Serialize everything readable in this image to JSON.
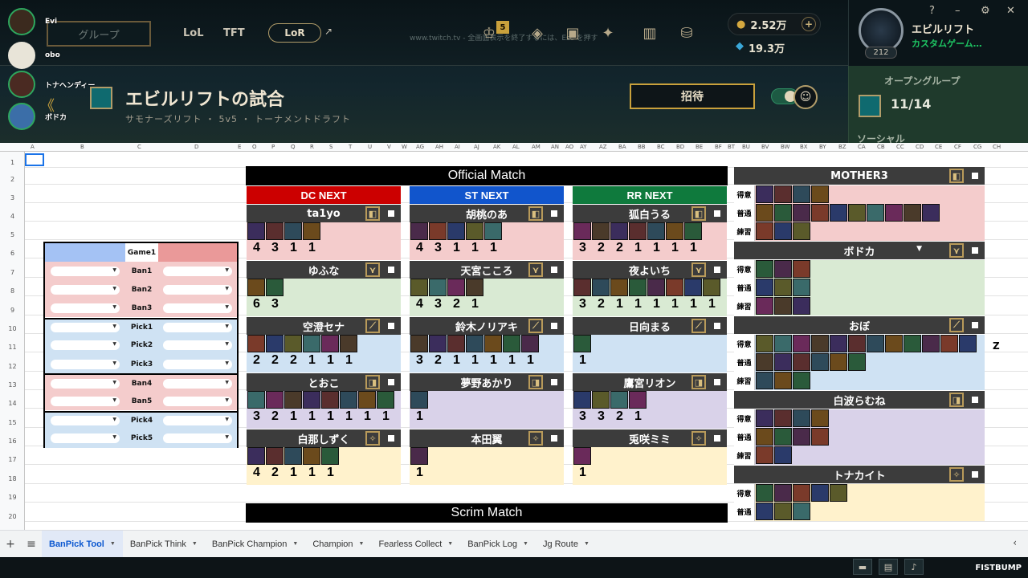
{
  "client": {
    "play_button": "グループ",
    "tabs": [
      "LoL",
      "TFT"
    ],
    "lor": "LoR",
    "twitch_note": "www.twitch.tv - 全画面表示を終了するには、Esc を押す",
    "badge": "5",
    "rp": "2.52万",
    "be": "19.3万",
    "profile_name": "エビルリフト",
    "profile_status": "カスタムゲーム…",
    "profile_level": "212",
    "lobby_title": "エビルリフトの試合",
    "lobby_sub": "サモナーズリフト ・ 5v5 ・ トーナメントドラフト",
    "invite": "招待",
    "open_group": "オープングループ",
    "group_count": "11/14",
    "social": "ソーシャル"
  },
  "friends": [
    {
      "name": "Evi"
    },
    {
      "name": "obo"
    },
    {
      "name": "トナヘンディー"
    },
    {
      "name": "ボドカ"
    }
  ],
  "sheet": {
    "columns": [
      "A",
      "B",
      "C",
      "D",
      "E",
      "O",
      "P",
      "Q",
      "R",
      "S",
      "T",
      "U",
      "V",
      "W",
      "AG",
      "AH",
      "AI",
      "AJ",
      "AK",
      "AL",
      "AM",
      "AN",
      "AO",
      "AY",
      "AZ",
      "BA",
      "BB",
      "BC",
      "BD",
      "BE",
      "BF",
      "BT",
      "BU",
      "BV",
      "BW",
      "BX",
      "BY",
      "BZ",
      "CA",
      "CB",
      "CC",
      "CD",
      "CE",
      "CF",
      "CG",
      "CH"
    ],
    "rows": [
      "1",
      "2",
      "3",
      "4",
      "5",
      "6",
      "7",
      "8",
      "9",
      "10",
      "11",
      "12",
      "13",
      "14",
      "15",
      "16",
      "17",
      "18",
      "19",
      "20"
    ],
    "pick_table": {
      "header": "Game1",
      "rows": [
        "Ban1",
        "Ban2",
        "Ban3",
        "Pick1",
        "Pick2",
        "Pick3",
        "Ban4",
        "Ban5",
        "Pick4",
        "Pick5"
      ]
    },
    "official_match": "Official Match",
    "scrim_match": "Scrim Match",
    "teams": [
      {
        "name": "DC NEXT",
        "color": "#cc0000",
        "players": [
          {
            "name": "ta1yo",
            "role": "top",
            "counts": [
              "4",
              "3",
              "1",
              "1"
            ],
            "champs": 4
          },
          {
            "name": "ゆふな",
            "role": "jg",
            "counts": [
              "6",
              "3"
            ],
            "champs": 2
          },
          {
            "name": "空澄セナ",
            "role": "mid",
            "counts": [
              "2",
              "2",
              "2",
              "1",
              "1",
              "1"
            ],
            "champs": 6
          },
          {
            "name": "とおこ",
            "role": "bot",
            "counts": [
              "3",
              "2",
              "1",
              "1",
              "1",
              "1",
              "1",
              "1"
            ],
            "champs": 8
          },
          {
            "name": "白那しずく",
            "role": "sup",
            "counts": [
              "4",
              "2",
              "1",
              "1",
              "1"
            ],
            "champs": 5
          }
        ]
      },
      {
        "name": "ST NEXT",
        "color": "#1155cc",
        "players": [
          {
            "name": "胡桃のあ",
            "role": "top",
            "counts": [
              "4",
              "3",
              "1",
              "1",
              "1"
            ],
            "champs": 5
          },
          {
            "name": "天宮こころ",
            "role": "jg",
            "counts": [
              "4",
              "3",
              "2",
              "1"
            ],
            "champs": 4
          },
          {
            "name": "鈴木ノリアキ",
            "role": "mid",
            "counts": [
              "3",
              "2",
              "1",
              "1",
              "1",
              "1",
              "1"
            ],
            "champs": 7
          },
          {
            "name": "夢野あかり",
            "role": "bot",
            "counts": [
              "1"
            ],
            "champs": 1
          },
          {
            "name": "本田翼",
            "role": "sup",
            "counts": [
              "1"
            ],
            "champs": 1
          }
        ]
      },
      {
        "name": "RR NEXT",
        "color": "#0f7a3d",
        "players": [
          {
            "name": "狐白うる",
            "role": "top",
            "counts": [
              "3",
              "2",
              "2",
              "1",
              "1",
              "1",
              "1"
            ],
            "champs": 7
          },
          {
            "name": "夜よいち",
            "role": "jg",
            "counts": [
              "3",
              "2",
              "1",
              "1",
              "1",
              "1",
              "1",
              "1"
            ],
            "champs": 8
          },
          {
            "name": "日向まる",
            "role": "mid",
            "counts": [
              "1"
            ],
            "champs": 1
          },
          {
            "name": "鷹宮リオン",
            "role": "bot",
            "counts": [
              "3",
              "3",
              "2",
              "1"
            ],
            "champs": 4
          },
          {
            "name": "兎咲ミミ",
            "role": "sup",
            "counts": [
              "1"
            ],
            "champs": 1
          }
        ]
      }
    ],
    "pool_team": "MOTHER3",
    "pool_players": [
      {
        "name": "MOTHER3",
        "tiers": [
          {
            "label": "得意",
            "champs": 4
          },
          {
            "label": "普通",
            "champs": 10
          },
          {
            "label": "練習",
            "champs": 3
          }
        ],
        "bg": "#f4cccc"
      },
      {
        "name": "ボドカ",
        "tiers": [
          {
            "label": "得意",
            "champs": 3
          },
          {
            "label": "普通",
            "champs": 3
          },
          {
            "label": "練習",
            "champs": 3
          }
        ],
        "bg": "#d9ead3"
      },
      {
        "name": "おぼ",
        "tiers": [
          {
            "label": "得意",
            "champs": 12
          },
          {
            "label": "普通",
            "champs": 6
          },
          {
            "label": "練習",
            "champs": 3
          }
        ],
        "bg": "#cfe2f3"
      },
      {
        "name": "白波らむね",
        "tiers": [
          {
            "label": "得意",
            "champs": 4
          },
          {
            "label": "普通",
            "champs": 4
          },
          {
            "label": "練習",
            "champs": 2
          }
        ],
        "bg": "#d9d2e9"
      },
      {
        "name": "トナカイト",
        "tiers": [
          {
            "label": "得意",
            "champs": 5
          },
          {
            "label": "普通",
            "champs": 3
          }
        ],
        "bg": "#fff2cc"
      }
    ],
    "z_mark": "Z"
  },
  "tabs": [
    "BanPick Tool",
    "BanPick Think",
    "BanPick Champion",
    "Champion",
    "Fearless Collect",
    "BanPick Log",
    "Jg Route"
  ],
  "active_tab": "BanPick Tool",
  "bottom": {
    "brand": "FISTBUMP"
  }
}
